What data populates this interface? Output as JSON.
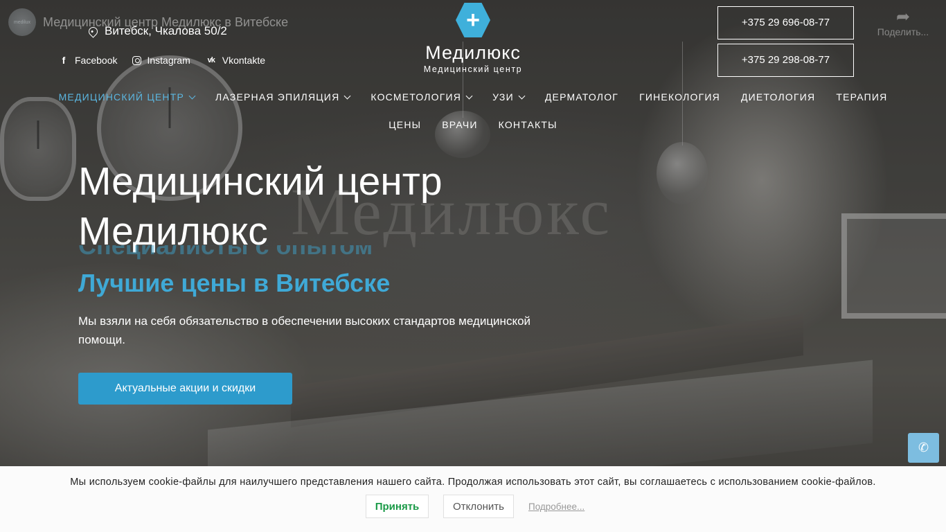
{
  "video": {
    "title": "Медицинский центр Медилюкс в Витебске",
    "channel_avatar_text": "medilux",
    "share_label": "Поделить..."
  },
  "header": {
    "address": "Витебск, Чкалова 50/2",
    "socials": [
      {
        "label": "Facebook",
        "icon": "facebook-icon"
      },
      {
        "label": "Instagram",
        "icon": "instagram-icon"
      },
      {
        "label": "Vkontakte",
        "icon": "vk-icon"
      }
    ],
    "logo": {
      "name": "Медилюкс",
      "subtitle": "Медицинский центр",
      "symbol": "+"
    },
    "phones": [
      "+375 29 696-08-77",
      "+375 29 298-08-77"
    ]
  },
  "nav": [
    {
      "label": "Медицинский центр",
      "dropdown": true,
      "active": true
    },
    {
      "label": "Лазерная эпиляция",
      "dropdown": true,
      "active": false
    },
    {
      "label": "Косметология",
      "dropdown": true,
      "active": false
    },
    {
      "label": "УЗИ",
      "dropdown": true,
      "active": false
    },
    {
      "label": "Дерматолог",
      "dropdown": false,
      "active": false
    },
    {
      "label": "Гинекология",
      "dropdown": false,
      "active": false
    },
    {
      "label": "Диетология",
      "dropdown": false,
      "active": false
    },
    {
      "label": "Терапия",
      "dropdown": false,
      "active": false
    },
    {
      "label": "Цены",
      "dropdown": false,
      "active": false
    },
    {
      "label": "Врачи",
      "dropdown": false,
      "active": false
    },
    {
      "label": "Контакты",
      "dropdown": false,
      "active": false
    }
  ],
  "hero": {
    "title_line1": "Медицинский центр",
    "title_line2": "Медилюкс",
    "rotator_prev": "Специалисты с опытом",
    "rotator_current": "Лучшие цены в Витебске",
    "description": "Мы взяли на себя обязательство в обеспечении высоких стандартов медицинской помощи.",
    "cta_label": "Актуальные акции и скидки",
    "wall_letters": "Медилюкс"
  },
  "cookie": {
    "text": "Мы используем cookie-файлы для наилучшего представления нашего сайта. Продолжая использовать этот сайт, вы соглашаетесь с использованием cookie-файлов.",
    "accept_label": "Принять",
    "decline_label": "Отклонить",
    "more_label": "Подробнее..."
  },
  "colors": {
    "accent": "#3fa9d6",
    "cta": "#2d9bcc",
    "accept_text": "#1a9a47"
  }
}
